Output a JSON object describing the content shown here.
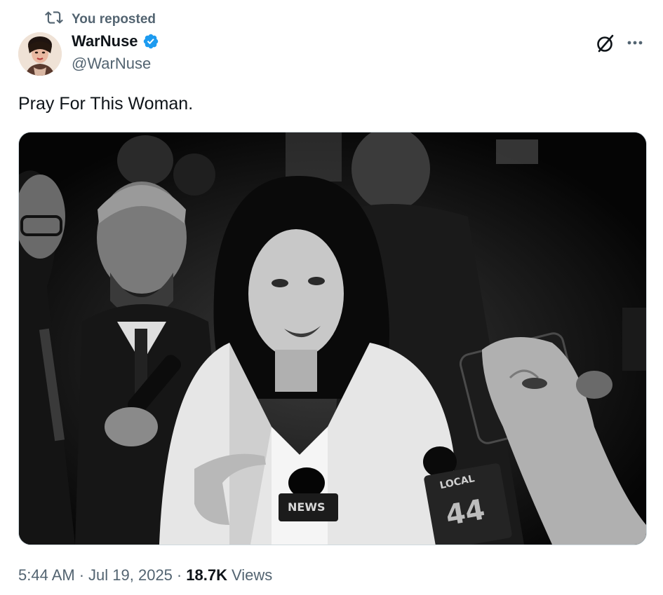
{
  "repost": {
    "label": "You reposted"
  },
  "author": {
    "display_name": "WarNuse",
    "handle": "@WarNuse",
    "verified": true,
    "verified_color": "#1d9bf0"
  },
  "tweet": {
    "text": "Pray For This Woman."
  },
  "media": {
    "type": "photo",
    "visible_text": [
      "NEWS",
      "LOCAL",
      "44"
    ]
  },
  "meta": {
    "time": "5:44 AM",
    "separator": "·",
    "date": "Jul 19, 2025",
    "views_count": "18.7K",
    "views_label": "Views"
  },
  "icons": {
    "repost": "repost-icon",
    "verified": "verified-badge-icon",
    "grok": "grok-icon",
    "more": "more-options-icon"
  }
}
